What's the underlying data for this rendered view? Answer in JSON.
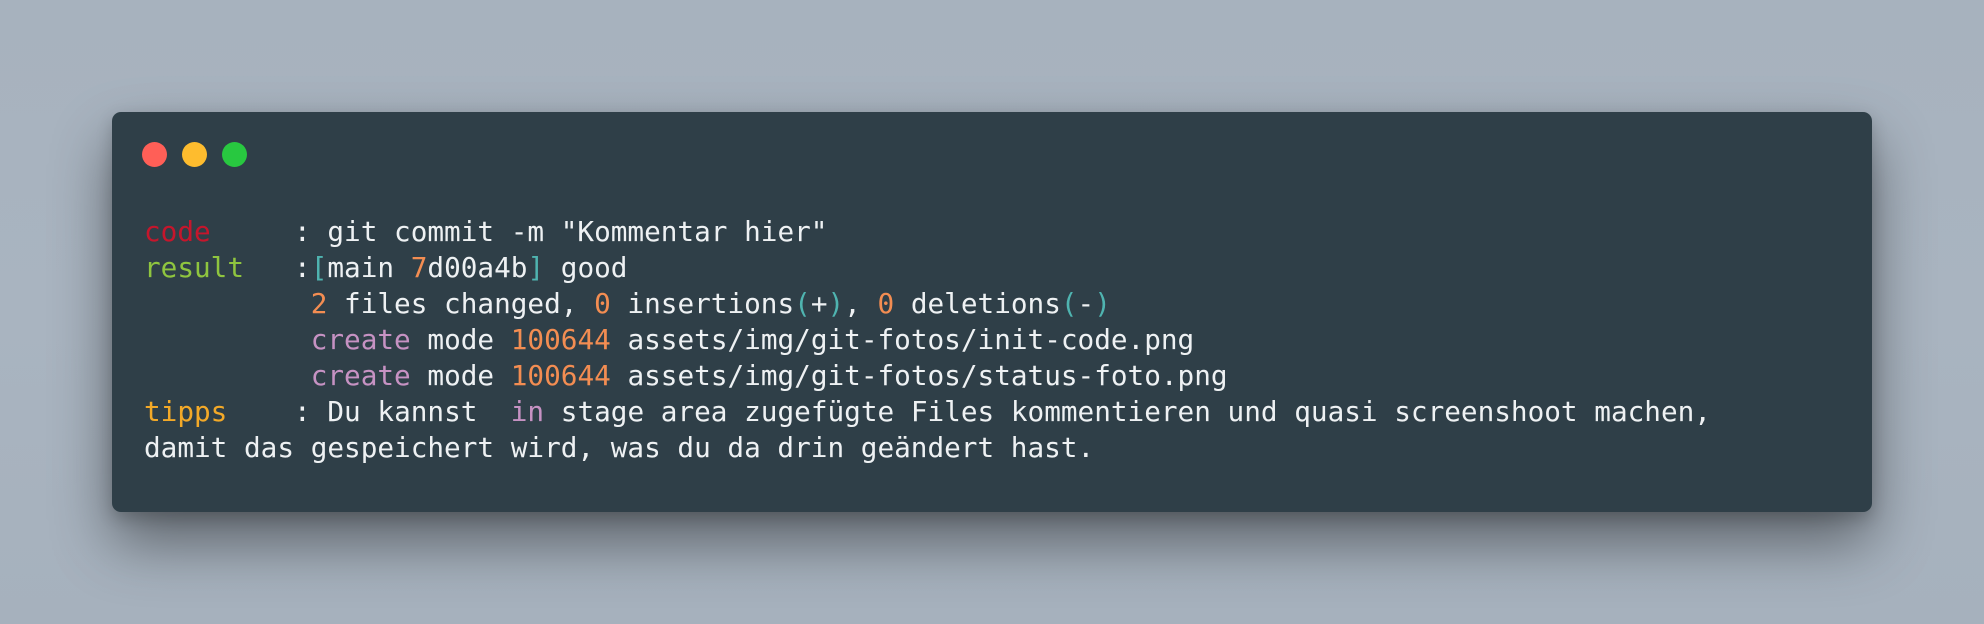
{
  "window": {
    "controls": [
      "close",
      "minimize",
      "maximize"
    ],
    "colors": {
      "background": "#2f3f48",
      "close": "#ff5f57",
      "minimize": "#febc2e",
      "maximize": "#28c840"
    }
  },
  "terminal": {
    "code": {
      "key": "code",
      "sep": "     : ",
      "command": "git commit -m \"Kommentar hier\""
    },
    "result": {
      "key": "result",
      "sep": "   :",
      "bracket_open": "[",
      "branch": "main ",
      "hash_digit": "7",
      "hash_rest": "d00a4b",
      "bracket_close": "]",
      "status": " good",
      "summary": {
        "indent": "          ",
        "files_count": "2",
        "files_text": " files changed, ",
        "insertions_count": "0",
        "insertions_text": " insertions",
        "plus_open": "(",
        "plus": "+",
        "plus_close": ")",
        "comma": ", ",
        "deletions_count": "0",
        "deletions_text": " deletions",
        "minus_open": "(",
        "minus": "-",
        "minus_close": ")"
      },
      "files": [
        {
          "indent": "          ",
          "action": "create",
          "mode_label": " mode ",
          "mode": "100644",
          "path": " assets/img/git-fotos/init-code.png"
        },
        {
          "indent": "          ",
          "action": "create",
          "mode_label": " mode ",
          "mode": "100644",
          "path": " assets/img/git-fotos/status-foto.png"
        }
      ]
    },
    "tipps": {
      "key": "tipps",
      "sep": "    : ",
      "text_before": "Du kannst  ",
      "keyword": "in",
      "text_after": " stage area zugefügte Files kommentieren und quasi screenshoot machen,",
      "line2": "damit das gespeichert wird, was du da drin geändert hast."
    }
  }
}
